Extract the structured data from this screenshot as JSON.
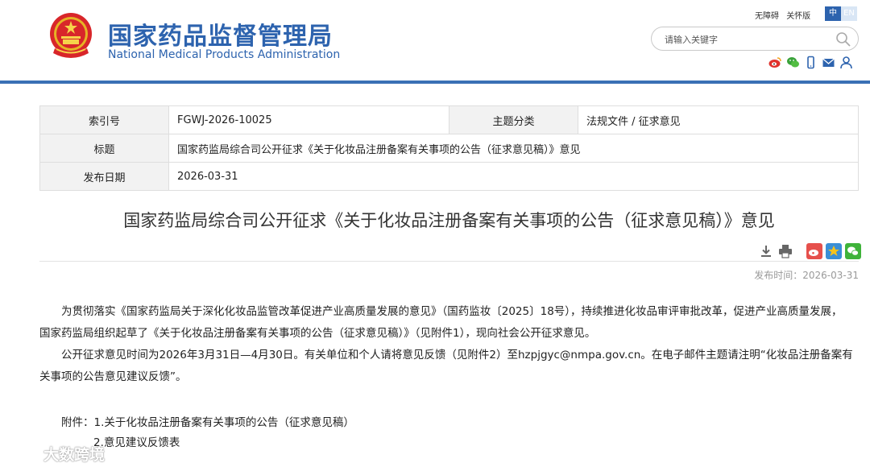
{
  "header": {
    "title_cn": "国家药品监督管理局",
    "title_en": "National Medical Products Administration",
    "top_links": [
      "无障碍",
      "关怀版"
    ],
    "lang_active": "中",
    "lang_inactive": "EN",
    "search_placeholder": "请输入关键字",
    "social_icons": [
      "weibo-icon",
      "wechat-icon",
      "mobile-icon",
      "mail-icon",
      "user-icon"
    ]
  },
  "meta": {
    "index_label": "索引号",
    "index_value": "FGWJ-2026-10025",
    "category_label": "主题分类",
    "category_value": "法规文件 / 征求意见",
    "title_label": "标题",
    "title_value": "国家药监局综合司公开征求《关于化妆品注册备案有关事项的公告（征求意见稿）》意见",
    "date_label": "发布日期",
    "date_value": "2026-03-31"
  },
  "article": {
    "title": "国家药监局综合司公开征求《关于化妆品注册备案有关事项的公告（征求意见稿）》意见",
    "publish_time": "发布时间：2026-03-31",
    "paragraph1_line1": "为贯彻落实《国家药监局关于深化化妆品监管改革促进产业高质量发展的意见》（国药监妆〔2025〕18号），持续推进化妆品审评审批改革，促进产业高质量发展，",
    "paragraph1_line2": "国家药监局组织起草了《关于化妆品注册备案有关事项的公告（征求意见稿）》（见附件1），现向社会公开征求意见。",
    "paragraph2_line1": "公开征求意见时间为2026年3月31日—4月30日。有关单位和个人请将意见反馈（见附件2）至hzpjgyc@nmpa.gov.cn。在电子邮件主题请注明“化妆品注册备案有",
    "paragraph2_line2": "关事项的公告意见建议反馈”。",
    "attachment_label": "附件：",
    "attachment1": "1.关于化妆品注册备案有关事项的公告（征求意见稿）",
    "attachment2": "2.意见建议反馈表"
  },
  "tools": [
    "download-icon",
    "print-icon",
    "share-weibo-icon",
    "share-qzone-icon",
    "share-wechat-icon"
  ],
  "watermark_text": "大数跨境",
  "colors": {
    "brand_blue": "#2d63ae",
    "rule_blue": "#3a70b5",
    "label_bg": "#f2f2f2"
  }
}
